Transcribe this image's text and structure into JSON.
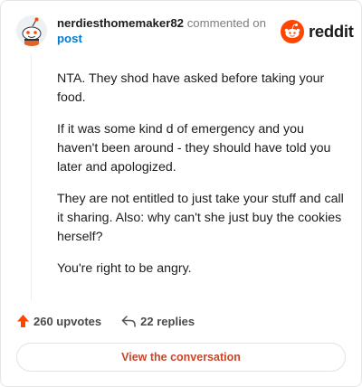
{
  "header": {
    "username": "nerdiesthomemaker82",
    "action_text": "commented on",
    "post_link": "post",
    "brand": "reddit"
  },
  "comment": {
    "paragraphs": [
      "NTA. They shod have asked before taking your food.",
      "If it was some kind d of emergency and you haven't been around - they should have told you later and apologized.",
      "They are not entitled to just take your stuff and call it sharing. Also: why can't she just buy the cookies herself?",
      "You're right to be angry."
    ]
  },
  "stats": {
    "upvotes": "260 upvotes",
    "replies": "22 replies"
  },
  "cta": {
    "label": "View the conversation"
  },
  "colors": {
    "brand_orange": "#ff4500",
    "link_blue": "#0079d3",
    "cta_text": "#c9462a"
  },
  "icons": {
    "avatar": "snoo-avatar-icon",
    "logo": "reddit-logo-icon",
    "upvote": "upvote-arrow-icon",
    "reply": "reply-arrow-icon"
  }
}
